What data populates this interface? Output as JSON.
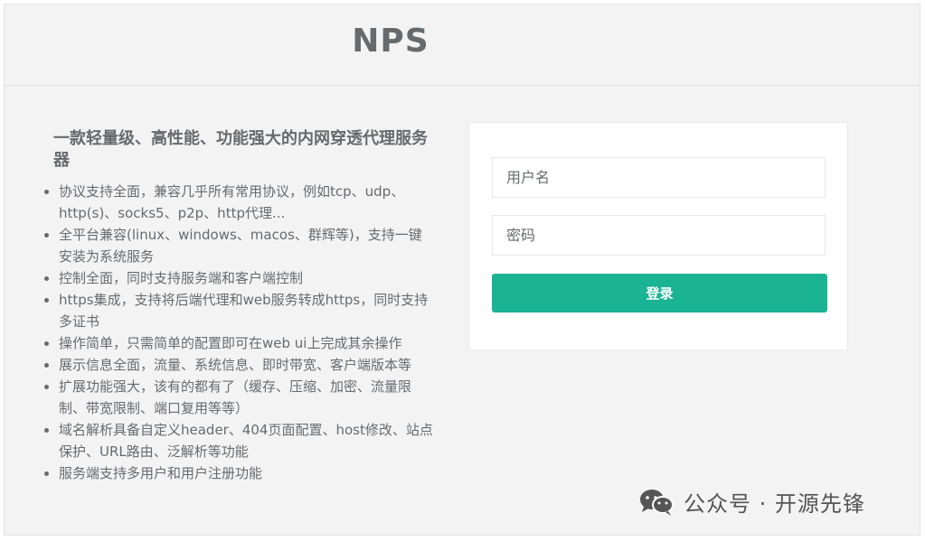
{
  "header": {
    "logo": "NPS"
  },
  "intro": {
    "headline": "一款轻量级、高性能、功能强大的内网穿透代理服务器",
    "features": [
      "协议支持全面，兼容几乎所有常用协议，例如tcp、udp、http(s)、socks5、p2p、http代理...",
      "全平台兼容(linux、windows、macos、群辉等)，支持一键安装为系统服务",
      "控制全面，同时支持服务端和客户端控制",
      "https集成，支持将后端代理和web服务转成https，同时支持多证书",
      "操作简单，只需简单的配置即可在web ui上完成其余操作",
      "展示信息全面，流量、系统信息、即时带宽、客户端版本等",
      "扩展功能强大，该有的都有了（缓存、压缩、加密、流量限制、带宽限制、端口复用等等）",
      "域名解析具备自定义header、404页面配置、host修改、站点保护、URL路由、泛解析等功能",
      "服务端支持多用户和用户注册功能"
    ]
  },
  "login": {
    "username_placeholder": "用户名",
    "username_value": "",
    "password_placeholder": "密码",
    "password_value": "",
    "submit_label": "登录"
  },
  "watermark": {
    "icon": "wechat-icon",
    "text": "公众号 · 开源先锋"
  },
  "colors": {
    "accent": "#1ab394",
    "page_bg": "#f3f3f4",
    "text": "#676a6c"
  }
}
